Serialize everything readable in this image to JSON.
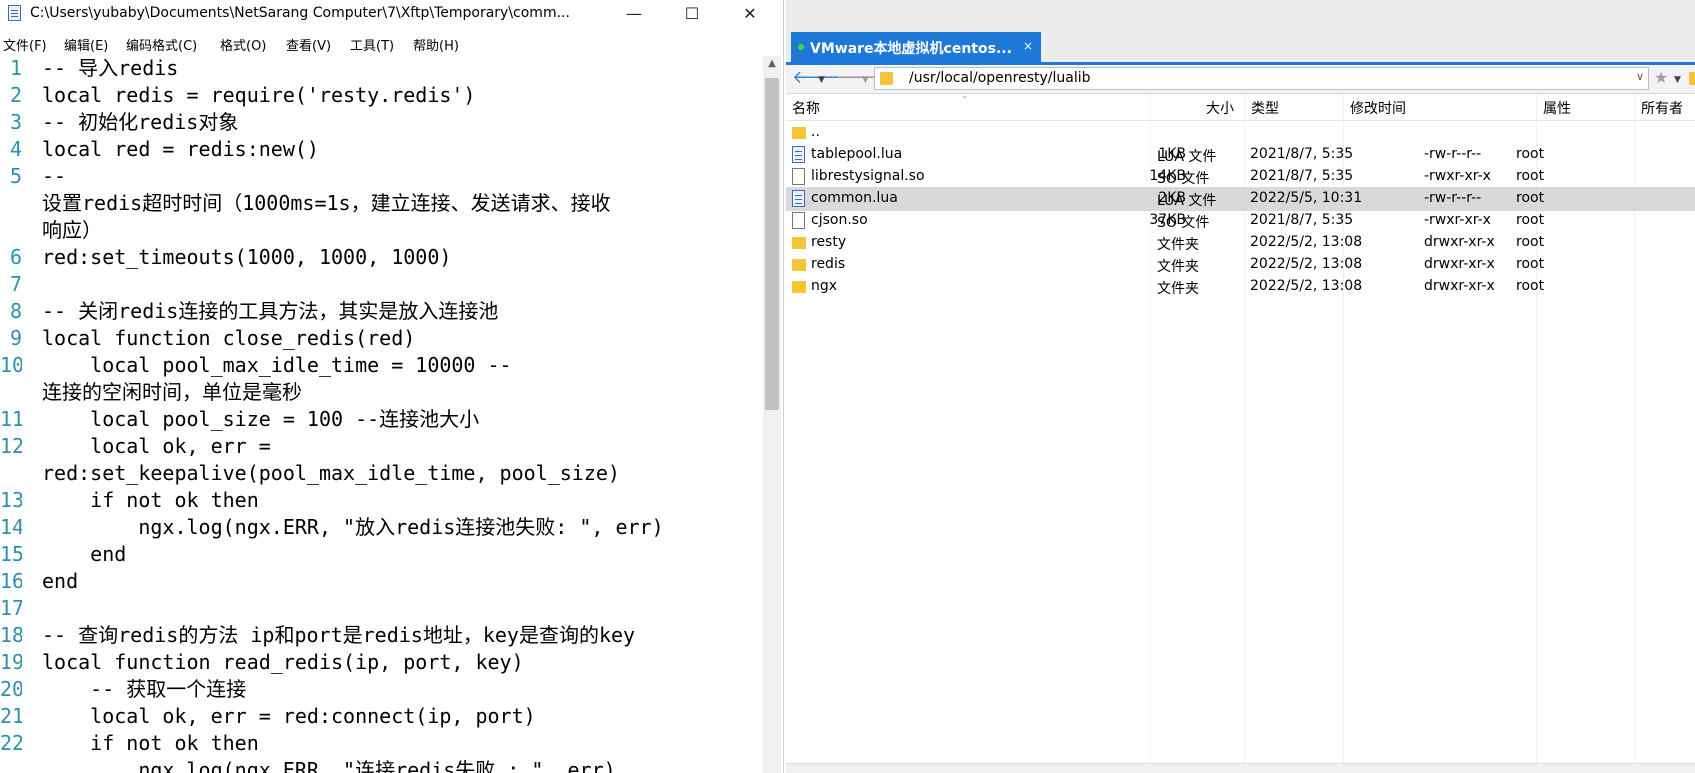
{
  "notepad": {
    "title": "C:\\Users\\yubaby\\Documents\\NetSarang Computer\\7\\Xftp\\Temporary\\comm...",
    "window_buttons": {
      "minimize": "—",
      "maximize": "☐",
      "close": "✕"
    },
    "menu": [
      "文件(F)",
      "编辑(E)",
      "编码格式(C)",
      "格式(O)",
      "查看(V)",
      "工具(T)",
      "帮助(H)"
    ],
    "code": [
      {
        "n": "1",
        "text": "-- 导入redis"
      },
      {
        "n": "2",
        "text": "local redis = require('resty.redis')"
      },
      {
        "n": "3",
        "text": "-- 初始化redis对象"
      },
      {
        "n": "4",
        "text": "local red = redis:new()"
      },
      {
        "n": "5",
        "text": "--"
      },
      {
        "n": "",
        "text": "设置redis超时时间（1000ms=1s，建立连接、发送请求、接收"
      },
      {
        "n": "",
        "text": "响应）"
      },
      {
        "n": "6",
        "text": "red:set_timeouts(1000, 1000, 1000)"
      },
      {
        "n": "7",
        "text": ""
      },
      {
        "n": "8",
        "text": "-- 关闭redis连接的工具方法，其实是放入连接池"
      },
      {
        "n": "9",
        "text": "local function close_redis(red)"
      },
      {
        "n": "10",
        "text": "    local pool_max_idle_time = 10000 --"
      },
      {
        "n": "",
        "text": "连接的空闲时间，单位是毫秒"
      },
      {
        "n": "11",
        "text": "    local pool_size = 100 --连接池大小"
      },
      {
        "n": "12",
        "text": "    local ok, err ="
      },
      {
        "n": "",
        "text": "red:set_keepalive(pool_max_idle_time, pool_size)"
      },
      {
        "n": "13",
        "text": "    if not ok then"
      },
      {
        "n": "14",
        "text": "        ngx.log(ngx.ERR, \"放入redis连接池失败: \", err)"
      },
      {
        "n": "15",
        "text": "    end"
      },
      {
        "n": "16",
        "text": "end"
      },
      {
        "n": "17",
        "text": ""
      },
      {
        "n": "18",
        "text": "-- 查询redis的方法 ip和port是redis地址，key是查询的key"
      },
      {
        "n": "19",
        "text": "local function read_redis(ip, port, key)"
      },
      {
        "n": "20",
        "text": "    -- 获取一个连接"
      },
      {
        "n": "21",
        "text": "    local ok, err = red:connect(ip, port)"
      },
      {
        "n": "22",
        "text": "    if not ok then"
      },
      {
        "n": "",
        "text": "        ngx.log(ngx.ERR, \"连接redis失败 : \", err)"
      }
    ]
  },
  "xftp": {
    "tab_label": "VMware本地虚拟机centos...",
    "tab_close": "×",
    "path": "/usr/local/openresty/lualib",
    "columns": {
      "name": "名称",
      "size": "大小",
      "type": "类型",
      "mtime": "修改时间",
      "attr": "属性",
      "owner": "所有者"
    },
    "files": [
      {
        "icon": "folder-icon",
        "name": "..",
        "size": "",
        "type": "",
        "mtime": "",
        "attr": "",
        "owner": ""
      },
      {
        "icon": "lua-file-icon",
        "name": "tablepool.lua",
        "size": "1KB",
        "type": "LUA 文件",
        "mtime": "2021/8/7, 5:35",
        "attr": "-rw-r--r--",
        "owner": "root"
      },
      {
        "icon": "file-icon",
        "name": "librestysignal.so",
        "size": "14KB",
        "type": "SO 文件",
        "mtime": "2021/8/7, 5:35",
        "attr": "-rwxr-xr-x",
        "owner": "root"
      },
      {
        "icon": "lua-file-icon",
        "name": "common.lua",
        "size": "2KB",
        "type": "LUA 文件",
        "mtime": "2022/5/5, 10:31",
        "attr": "-rw-r--r--",
        "owner": "root",
        "selected": true
      },
      {
        "icon": "file-icon",
        "name": "cjson.so",
        "size": "37KB",
        "type": "SO 文件",
        "mtime": "2021/8/7, 5:35",
        "attr": "-rwxr-xr-x",
        "owner": "root"
      },
      {
        "icon": "folder-icon",
        "name": "resty",
        "size": "",
        "type": "文件夹",
        "mtime": "2022/5/2, 13:08",
        "attr": "drwxr-xr-x",
        "owner": "root"
      },
      {
        "icon": "folder-icon",
        "name": "redis",
        "size": "",
        "type": "文件夹",
        "mtime": "2022/5/2, 13:08",
        "attr": "drwxr-xr-x",
        "owner": "root"
      },
      {
        "icon": "folder-icon",
        "name": "ngx",
        "size": "",
        "type": "文件夹",
        "mtime": "2022/5/2, 13:08",
        "attr": "drwxr-xr-x",
        "owner": "root"
      }
    ]
  }
}
